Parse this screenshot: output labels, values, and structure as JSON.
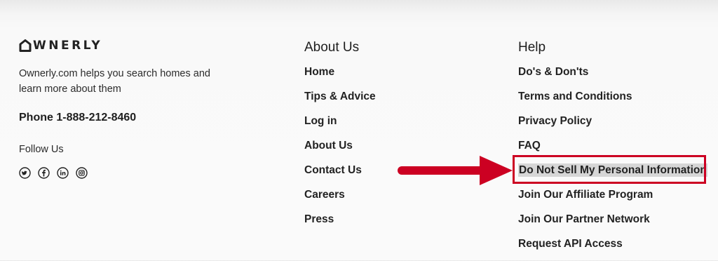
{
  "brand": {
    "name": "WNERLY",
    "description": "Ownerly.com helps you search homes and learn more about them",
    "phone": "Phone 1-888-212-8460",
    "follow_label": "Follow Us"
  },
  "social_icons": [
    "twitter-icon",
    "facebook-icon",
    "linkedin-icon",
    "instagram-icon"
  ],
  "about": {
    "heading": "About Us",
    "links": [
      "Home",
      "Tips & Advice",
      "Log in",
      "About Us",
      "Contact Us",
      "Careers",
      "Press"
    ]
  },
  "help": {
    "heading": "Help",
    "links": [
      "Do's & Don'ts",
      "Terms and Conditions",
      "Privacy Policy",
      "FAQ",
      "Do Not Sell My Personal Information",
      "Join Our Affiliate Program",
      "Join Our Partner Network",
      "Request API Access"
    ]
  },
  "annotation": {
    "color": "#cc0022",
    "highlight_color": "#d6d6d6"
  }
}
